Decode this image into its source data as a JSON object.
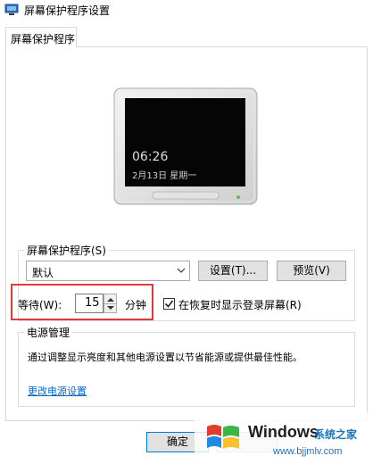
{
  "window": {
    "title": "屏幕保护程序设置"
  },
  "tabs": [
    {
      "label": "屏幕保护程序"
    }
  ],
  "preview": {
    "time": "06:26",
    "date": "2月13日  星期一"
  },
  "screensaver_group": {
    "label": "屏幕保护程序(S)",
    "selected": "默认",
    "settings_label": "设置(T)...",
    "preview_label": "预览(V)"
  },
  "wait": {
    "label": "等待(W):",
    "value": "15",
    "unit": "分钟",
    "resume_checked": true,
    "resume_label": "在恢复时显示登录屏幕(R)"
  },
  "power_group": {
    "label": "电源管理",
    "description": "通过调整显示亮度和其他电源设置以节省能源或提供最佳性能。",
    "link": "更改电源设置"
  },
  "footer": {
    "ok_label": "确定",
    "cancel_label": ""
  },
  "watermark": {
    "brand": "Windows",
    "cn": "系统之家",
    "url": "www.bjjmlv.com"
  },
  "colors": {
    "highlight": "#e03a3a",
    "link": "#0066cc",
    "led": "#5fbf4a"
  }
}
